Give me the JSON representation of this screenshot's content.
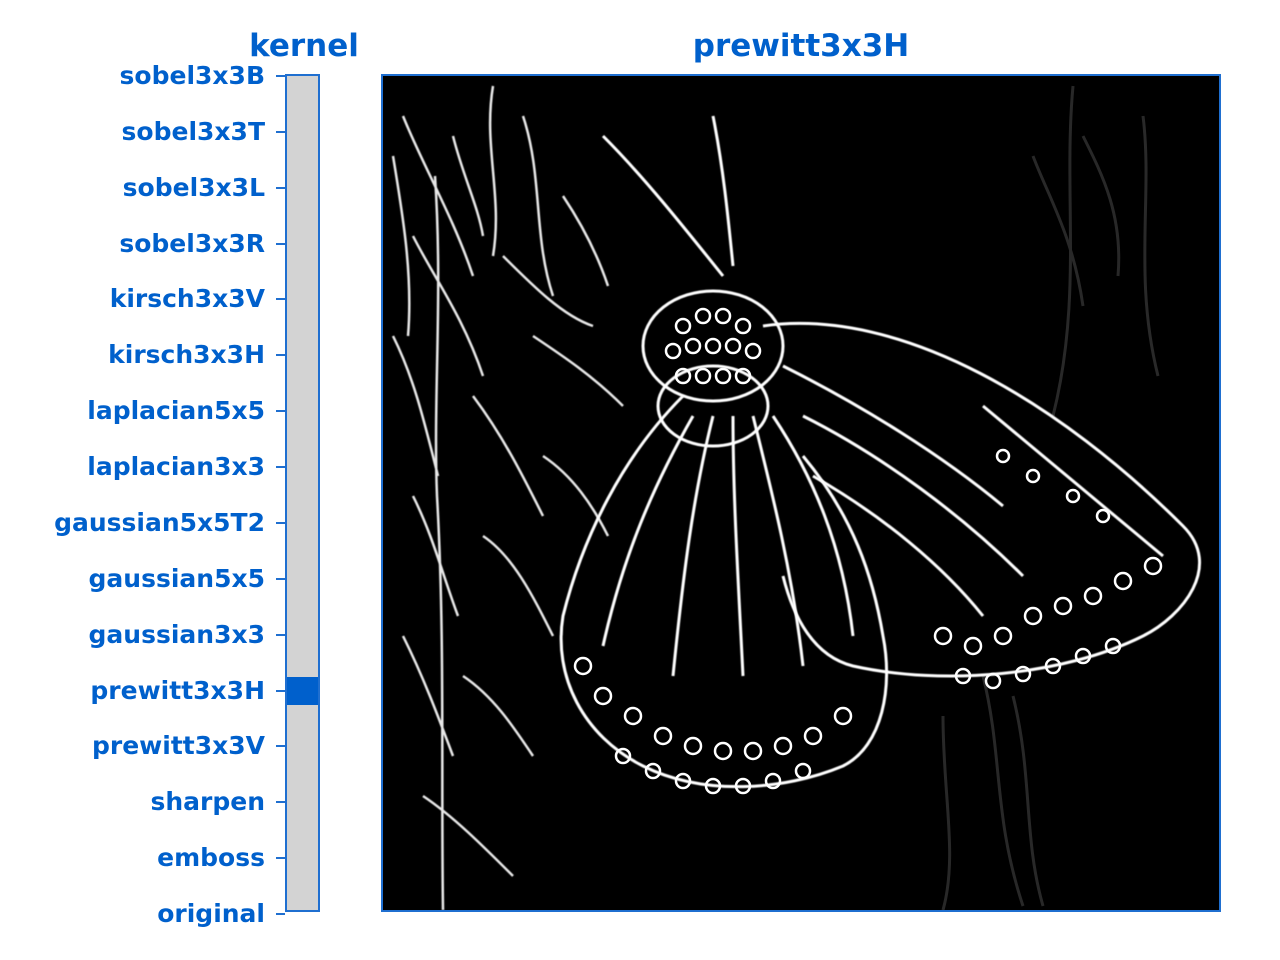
{
  "kernel_selector": {
    "title": "kernel",
    "selected": "prewitt3x3H",
    "options": [
      "sobel3x3B",
      "sobel3x3T",
      "sobel3x3L",
      "sobel3x3R",
      "kirsch3x3V",
      "kirsch3x3H",
      "laplacian5x5",
      "laplacian3x3",
      "gaussian5x5T2",
      "gaussian5x5",
      "gaussian3x3",
      "prewitt3x3H",
      "prewitt3x3V",
      "sharpen",
      "emboss",
      "original"
    ]
  },
  "image_view": {
    "title": "prewitt3x3H",
    "content": "edge-filtered monarch butterfly on plant stalk"
  },
  "colors": {
    "accent": "#0060cc",
    "slider_track": "#d3d3d3",
    "frame_border": "#1f6fd0",
    "image_background": "#000000"
  }
}
